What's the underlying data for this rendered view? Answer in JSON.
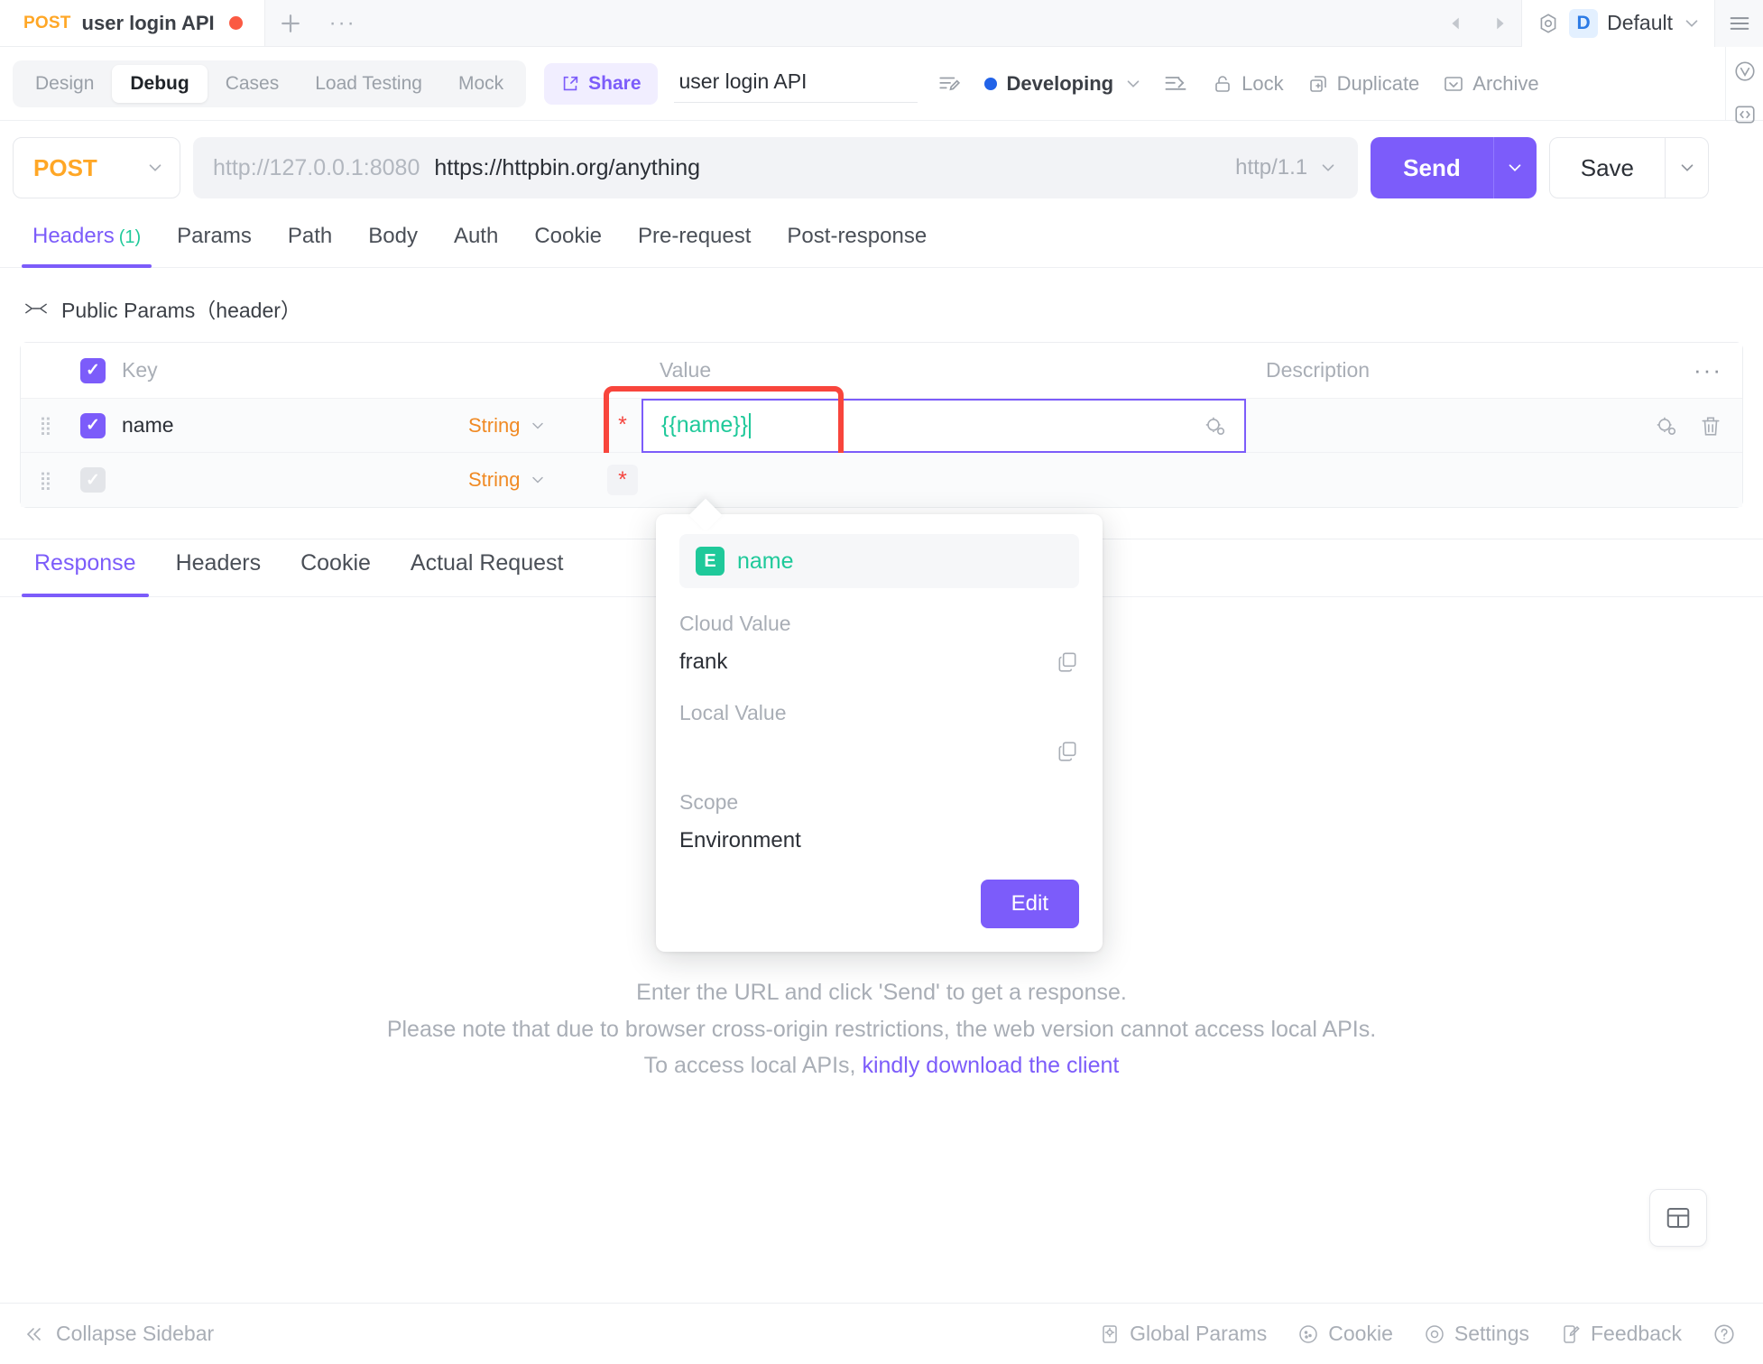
{
  "tabstrip": {
    "tab": {
      "method": "POST",
      "title": "user login API",
      "unsaved_dot": "●"
    },
    "new_tab_label": "+",
    "more_label": "···",
    "environment": {
      "badge": "D",
      "name": "Default"
    }
  },
  "actionbar": {
    "segments": [
      {
        "label": "Design",
        "active": false
      },
      {
        "label": "Debug",
        "active": true
      },
      {
        "label": "Cases",
        "active": false
      },
      {
        "label": "Load Testing",
        "active": false
      },
      {
        "label": "Mock",
        "active": false
      }
    ],
    "share_label": "Share",
    "api_name": "user login API",
    "status_label": "Developing",
    "buttons": [
      {
        "label": "Lock",
        "icon": "lock-icon"
      },
      {
        "label": "Duplicate",
        "icon": "duplicate-icon"
      },
      {
        "label": "Archive",
        "icon": "archive-icon"
      }
    ]
  },
  "urlbar": {
    "method": "POST",
    "url_prefix": "http://127.0.0.1:8080",
    "url_value": "https://httpbin.org/anything",
    "protocol": "http/1.1",
    "send_label": "Send",
    "save_label": "Save"
  },
  "request_tabs": [
    {
      "label": "Headers",
      "count": "(1)",
      "active": true
    },
    {
      "label": "Params",
      "count": "",
      "active": false
    },
    {
      "label": "Path",
      "count": "",
      "active": false
    },
    {
      "label": "Body",
      "count": "",
      "active": false
    },
    {
      "label": "Auth",
      "count": "",
      "active": false
    },
    {
      "label": "Cookie",
      "count": "",
      "active": false
    },
    {
      "label": "Pre-request",
      "count": "",
      "active": false
    },
    {
      "label": "Post-response",
      "count": "",
      "active": false
    }
  ],
  "public_params": {
    "label": "Public Params（header）"
  },
  "param_table": {
    "headers": {
      "key": "Key",
      "value": "Value",
      "description": "Description",
      "more": "···"
    },
    "rows": [
      {
        "checked": true,
        "key": "name",
        "type": "String",
        "required_mark": "*",
        "value": "{{name}}",
        "description": "",
        "focused": true
      },
      {
        "checked": false,
        "key": "",
        "type": "String",
        "required_mark": "*",
        "value": "",
        "description": "",
        "focused": false
      }
    ]
  },
  "variable_popover": {
    "env_badge": "E",
    "variable_name": "name",
    "cloud_value_label": "Cloud Value",
    "cloud_value": "frank",
    "local_value_label": "Local Value",
    "local_value": "",
    "scope_label": "Scope",
    "scope_value": "Environment",
    "edit_label": "Edit"
  },
  "response_tabs": [
    {
      "label": "Response",
      "active": true
    },
    {
      "label": "Headers",
      "active": false
    },
    {
      "label": "Cookie",
      "active": false
    },
    {
      "label": "Actual Request",
      "active": false
    }
  ],
  "response_empty": {
    "line1": "Enter the URL and click 'Send' to get a response.",
    "line2": "Please note that due to browser cross-origin restrictions, the web version cannot access local APIs.",
    "line3_prefix": "To access local APIs, ",
    "line3_link": "kindly download the client"
  },
  "footer": {
    "collapse_label": "Collapse Sidebar",
    "items": [
      {
        "label": "Global Params",
        "icon": "global-params-icon"
      },
      {
        "label": "Cookie",
        "icon": "cookie-icon"
      },
      {
        "label": "Settings",
        "icon": "settings-icon"
      },
      {
        "label": "Feedback",
        "icon": "feedback-icon"
      }
    ],
    "help_icon": "help-icon"
  },
  "colors": {
    "accent": "#7c5cfa",
    "method": "#ffa726",
    "variable": "#1fc99a",
    "status": "#2263e8",
    "highlight_box": "#f8453c"
  }
}
